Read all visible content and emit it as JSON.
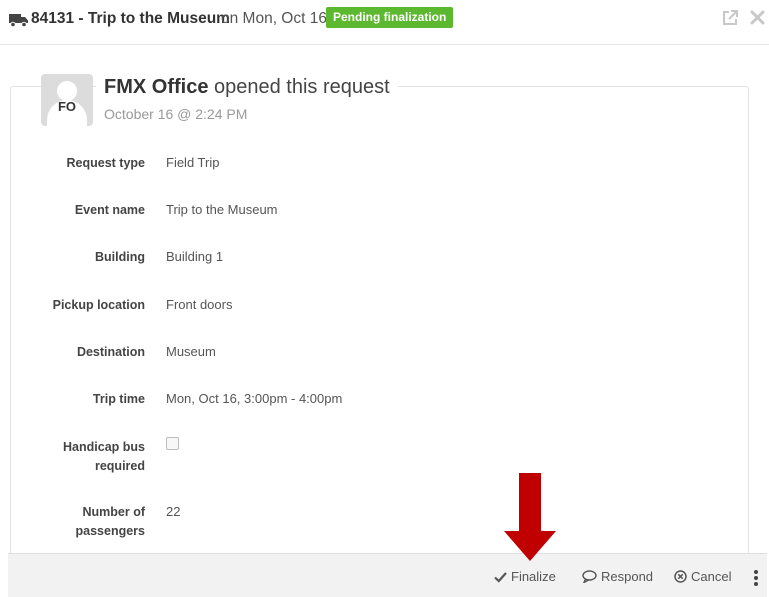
{
  "header": {
    "icon": "truck-icon",
    "title": "84131 - Trip to the Museum",
    "subtitle": "on Mon, Oct 16",
    "status_badge": "Pending finalization",
    "badge_color": "#5cb82e"
  },
  "request": {
    "avatar_initials": "FO",
    "opener_name": "FMX Office",
    "opener_action": "opened this request",
    "opened_date": "October 16 @ 2:24 PM"
  },
  "fields": [
    {
      "label": "Request type",
      "value": "Field Trip"
    },
    {
      "label": "Event name",
      "value": "Trip to the Museum"
    },
    {
      "label": "Building",
      "value": "Building 1"
    },
    {
      "label": "Pickup location",
      "value": "Front doors"
    },
    {
      "label": "Destination",
      "value": "Museum"
    },
    {
      "label": "Trip time",
      "value": "Mon, Oct 16, 3:00pm - 4:00pm"
    },
    {
      "label_line1": "Handicap bus",
      "label_line2": "required",
      "checked": false
    },
    {
      "label_line1": "Number of",
      "label_line2": "passengers",
      "value": "22"
    }
  ],
  "footer": {
    "finalize_label": "Finalize",
    "respond_label": "Respond",
    "cancel_label": "Cancel"
  },
  "annotation_color": "#c00000"
}
